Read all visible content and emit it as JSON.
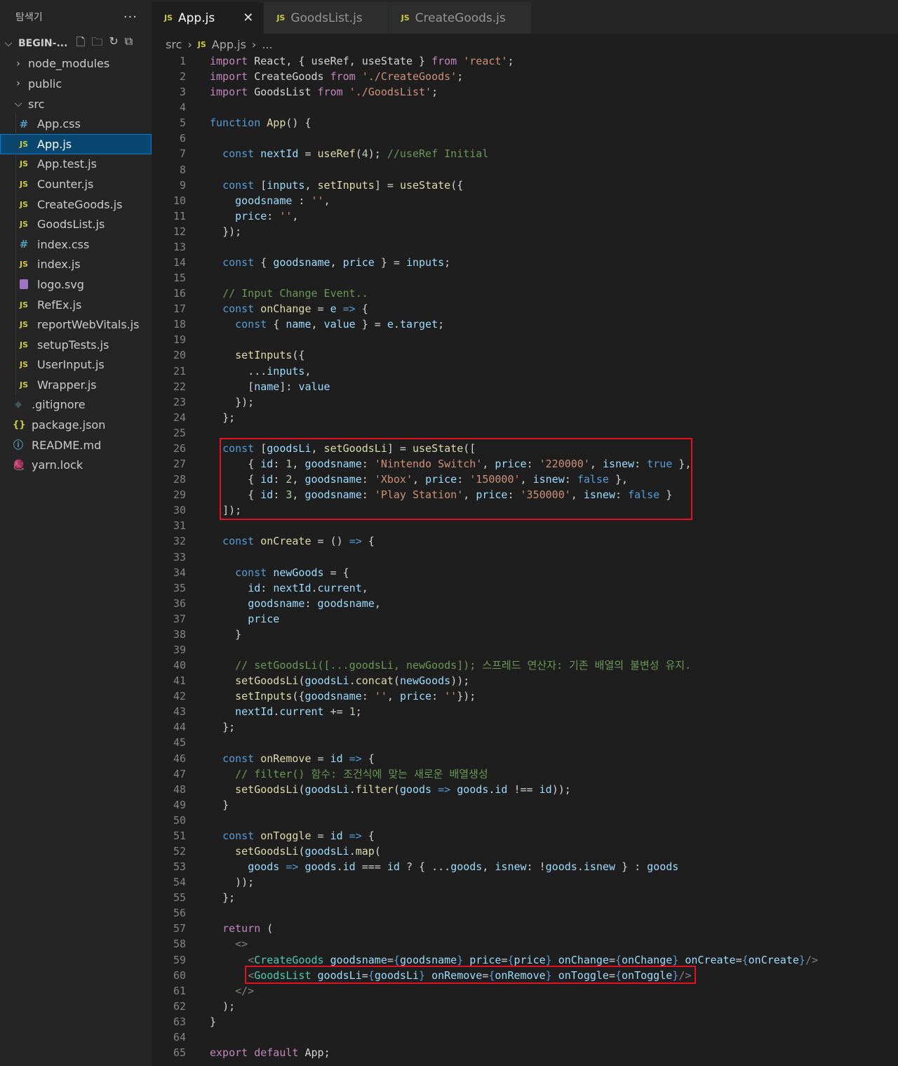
{
  "sidebar": {
    "title": "탐색기",
    "more": "···",
    "project": "BEGIN-...",
    "items": [
      {
        "label": "node_modules",
        "kind": "folder",
        "icon": "chevron-right-icon",
        "depth": 0
      },
      {
        "label": "public",
        "kind": "folder",
        "icon": "chevron-right-icon",
        "depth": 0
      },
      {
        "label": "src",
        "kind": "folder-open",
        "icon": "chevron-down-icon",
        "depth": 0
      },
      {
        "label": "App.css",
        "kind": "css",
        "icon": "hash-icon",
        "depth": 1
      },
      {
        "label": "App.js",
        "kind": "js",
        "icon": "js-icon",
        "depth": 1,
        "selected": true
      },
      {
        "label": "App.test.js",
        "kind": "js",
        "icon": "js-icon",
        "depth": 1
      },
      {
        "label": "Counter.js",
        "kind": "js",
        "icon": "js-icon",
        "depth": 1
      },
      {
        "label": "CreateGoods.js",
        "kind": "js",
        "icon": "js-icon",
        "depth": 1
      },
      {
        "label": "GoodsList.js",
        "kind": "js",
        "icon": "js-icon",
        "depth": 1
      },
      {
        "label": "index.css",
        "kind": "css",
        "icon": "hash-icon",
        "depth": 1
      },
      {
        "label": "index.js",
        "kind": "js",
        "icon": "js-icon",
        "depth": 1
      },
      {
        "label": "logo.svg",
        "kind": "svg",
        "icon": "svg-file-icon",
        "depth": 1
      },
      {
        "label": "RefEx.js",
        "kind": "js",
        "icon": "js-icon",
        "depth": 1
      },
      {
        "label": "reportWebVitals.js",
        "kind": "js",
        "icon": "js-icon",
        "depth": 1
      },
      {
        "label": "setupTests.js",
        "kind": "js",
        "icon": "js-icon",
        "depth": 1
      },
      {
        "label": "UserInput.js",
        "kind": "js",
        "icon": "js-icon",
        "depth": 1
      },
      {
        "label": "Wrapper.js",
        "kind": "js",
        "icon": "js-icon",
        "depth": 1
      },
      {
        "label": ".gitignore",
        "kind": "git",
        "icon": "git-icon",
        "depth": 0
      },
      {
        "label": "package.json",
        "kind": "json",
        "icon": "braces-icon",
        "depth": 0
      },
      {
        "label": "README.md",
        "kind": "info",
        "icon": "info-icon",
        "depth": 0
      },
      {
        "label": "yarn.lock",
        "kind": "yarn",
        "icon": "yarn-icon",
        "depth": 0
      }
    ]
  },
  "tabs": [
    {
      "label": "App.js",
      "active": true,
      "close": "✕"
    },
    {
      "label": "GoodsList.js",
      "active": false
    },
    {
      "label": "CreateGoods.js",
      "active": false
    }
  ],
  "breadcrumb": {
    "folder": "src",
    "file": "App.js",
    "more": "..."
  },
  "js_badge": "JS",
  "colors": {
    "keyword": "#569cd6",
    "control": "#c586c0",
    "string": "#ce9178",
    "variable": "#9cdcfe",
    "function": "#dcdcaa",
    "comment": "#6a9955",
    "number": "#b5cea8",
    "tag": "#4ec9b0",
    "text": "#d4d4d4",
    "highlight_box": "#e81123"
  },
  "code_lines": [
    [
      [
        "import ",
        "c"
      ],
      [
        "React",
        ""
      ],
      [
        ", { ",
        ""
      ],
      [
        "useRef",
        ""
      ],
      [
        ", ",
        ""
      ],
      [
        "useState",
        ""
      ],
      [
        " } ",
        ""
      ],
      [
        "from ",
        "c"
      ],
      [
        "'react'",
        "s"
      ],
      [
        ";",
        ""
      ]
    ],
    [
      [
        "import ",
        "c"
      ],
      [
        "CreateGoods ",
        ""
      ],
      [
        "from ",
        "c"
      ],
      [
        "'./CreateGoods'",
        "s"
      ],
      [
        ";",
        ""
      ]
    ],
    [
      [
        "import ",
        "c"
      ],
      [
        "GoodsList ",
        ""
      ],
      [
        "from ",
        "c"
      ],
      [
        "'./GoodsList'",
        "s"
      ],
      [
        ";",
        ""
      ]
    ],
    [],
    [
      [
        "function ",
        "k"
      ],
      [
        "App",
        "f"
      ],
      [
        "() {",
        ""
      ]
    ],
    [],
    [
      [
        "  "
      ],
      [
        "const ",
        "k"
      ],
      [
        "nextId",
        "v"
      ],
      [
        " = ",
        ""
      ],
      [
        "useRef",
        "f"
      ],
      [
        "(",
        ""
      ],
      [
        "4",
        "n"
      ],
      [
        "); ",
        ""
      ],
      [
        "//useRef Initial",
        "m"
      ]
    ],
    [],
    [
      [
        "  "
      ],
      [
        "const ",
        "k"
      ],
      [
        "[",
        ""
      ],
      [
        "inputs",
        "v"
      ],
      [
        ", ",
        ""
      ],
      [
        "setInputs",
        "f"
      ],
      [
        "] = ",
        ""
      ],
      [
        "useState",
        "f"
      ],
      [
        "({",
        ""
      ]
    ],
    [
      [
        "    "
      ],
      [
        "goodsname",
        "v"
      ],
      [
        " : ",
        ""
      ],
      [
        "''",
        "s"
      ],
      [
        ",",
        ""
      ]
    ],
    [
      [
        "    "
      ],
      [
        "price",
        "v"
      ],
      [
        ": ",
        ""
      ],
      [
        "''",
        "s"
      ],
      [
        ",",
        ""
      ]
    ],
    [
      [
        "  "
      ],
      [
        "});",
        ""
      ]
    ],
    [],
    [
      [
        "  "
      ],
      [
        "const ",
        "k"
      ],
      [
        "{ ",
        ""
      ],
      [
        "goodsname",
        "v"
      ],
      [
        ", ",
        ""
      ],
      [
        "price",
        "v"
      ],
      [
        " } = ",
        ""
      ],
      [
        "inputs",
        "v"
      ],
      [
        ";",
        ""
      ]
    ],
    [],
    [
      [
        "  "
      ],
      [
        "// Input Change Event..",
        "m"
      ]
    ],
    [
      [
        "  "
      ],
      [
        "const ",
        "k"
      ],
      [
        "onChange",
        "f"
      ],
      [
        " = ",
        ""
      ],
      [
        "e",
        "v"
      ],
      [
        " => ",
        "k"
      ],
      [
        "{",
        ""
      ]
    ],
    [
      [
        "    "
      ],
      [
        "const ",
        "k"
      ],
      [
        "{ ",
        ""
      ],
      [
        "name",
        "v"
      ],
      [
        ", ",
        ""
      ],
      [
        "value",
        "v"
      ],
      [
        " } = ",
        ""
      ],
      [
        "e",
        "v"
      ],
      [
        ".",
        ""
      ],
      [
        "target",
        "v"
      ],
      [
        ";",
        ""
      ]
    ],
    [],
    [
      [
        "    "
      ],
      [
        "setInputs",
        "f"
      ],
      [
        "({",
        ""
      ]
    ],
    [
      [
        "      "
      ],
      [
        "...",
        ""
      ],
      [
        "inputs",
        "v"
      ],
      [
        ",",
        ""
      ]
    ],
    [
      [
        "      "
      ],
      [
        "[",
        ""
      ],
      [
        "name",
        "v"
      ],
      [
        "]: ",
        ""
      ],
      [
        "value",
        "v"
      ]
    ],
    [
      [
        "    "
      ],
      [
        "});",
        ""
      ]
    ],
    [
      [
        "  "
      ],
      [
        "};",
        ""
      ]
    ],
    [],
    [
      [
        "  "
      ],
      [
        "const ",
        "k"
      ],
      [
        "[",
        ""
      ],
      [
        "goodsLi",
        "v"
      ],
      [
        ", ",
        ""
      ],
      [
        "setGoodsLi",
        "f"
      ],
      [
        "] = ",
        ""
      ],
      [
        "useState",
        "f"
      ],
      [
        "([",
        ""
      ]
    ],
    [
      [
        "      "
      ],
      [
        "{ ",
        ""
      ],
      [
        "id",
        "v"
      ],
      [
        ": ",
        ""
      ],
      [
        "1",
        "n"
      ],
      [
        ", ",
        ""
      ],
      [
        "goodsname",
        "v"
      ],
      [
        ": ",
        ""
      ],
      [
        "'Nintendo Switch'",
        "s"
      ],
      [
        ", ",
        ""
      ],
      [
        "price",
        "v"
      ],
      [
        ": ",
        ""
      ],
      [
        "'220000'",
        "s"
      ],
      [
        ", ",
        ""
      ],
      [
        "isnew",
        "v"
      ],
      [
        ": ",
        ""
      ],
      [
        "true",
        "k"
      ],
      [
        " },",
        ""
      ]
    ],
    [
      [
        "      "
      ],
      [
        "{ ",
        ""
      ],
      [
        "id",
        "v"
      ],
      [
        ": ",
        ""
      ],
      [
        "2",
        "n"
      ],
      [
        ", ",
        ""
      ],
      [
        "goodsname",
        "v"
      ],
      [
        ": ",
        ""
      ],
      [
        "'Xbox'",
        "s"
      ],
      [
        ", ",
        ""
      ],
      [
        "price",
        "v"
      ],
      [
        ": ",
        ""
      ],
      [
        "'150000'",
        "s"
      ],
      [
        ", ",
        ""
      ],
      [
        "isnew",
        "v"
      ],
      [
        ": ",
        ""
      ],
      [
        "false",
        "k"
      ],
      [
        " },",
        ""
      ]
    ],
    [
      [
        "      "
      ],
      [
        "{ ",
        ""
      ],
      [
        "id",
        "v"
      ],
      [
        ": ",
        ""
      ],
      [
        "3",
        "n"
      ],
      [
        ", ",
        ""
      ],
      [
        "goodsname",
        "v"
      ],
      [
        ": ",
        ""
      ],
      [
        "'Play Station'",
        "s"
      ],
      [
        ", ",
        ""
      ],
      [
        "price",
        "v"
      ],
      [
        ": ",
        ""
      ],
      [
        "'350000'",
        "s"
      ],
      [
        ", ",
        ""
      ],
      [
        "isnew",
        "v"
      ],
      [
        ": ",
        ""
      ],
      [
        "false",
        "k"
      ],
      [
        " }",
        ""
      ]
    ],
    [
      [
        "  "
      ],
      [
        "]);",
        ""
      ]
    ],
    [],
    [
      [
        "  "
      ],
      [
        "const ",
        "k"
      ],
      [
        "onCreate",
        "f"
      ],
      [
        " = () ",
        ""
      ],
      [
        "=> ",
        "k"
      ],
      [
        "{",
        ""
      ]
    ],
    [],
    [
      [
        "    "
      ],
      [
        "const ",
        "k"
      ],
      [
        "newGoods",
        "v"
      ],
      [
        " = {",
        ""
      ]
    ],
    [
      [
        "      "
      ],
      [
        "id",
        "v"
      ],
      [
        ": ",
        ""
      ],
      [
        "nextId",
        "v"
      ],
      [
        ".",
        ""
      ],
      [
        "current",
        "v"
      ],
      [
        ",",
        ""
      ]
    ],
    [
      [
        "      "
      ],
      [
        "goodsname",
        "v"
      ],
      [
        ": ",
        ""
      ],
      [
        "goodsname",
        "v"
      ],
      [
        ",",
        ""
      ]
    ],
    [
      [
        "      "
      ],
      [
        "price",
        "v"
      ]
    ],
    [
      [
        "    "
      ],
      [
        "}",
        ""
      ]
    ],
    [],
    [
      [
        "    "
      ],
      [
        "// setGoodsLi([...goodsLi, newGoods]); 스프레드 연산자: 기존 배열의 불변성 유지.",
        "m"
      ]
    ],
    [
      [
        "    "
      ],
      [
        "setGoodsLi",
        "f"
      ],
      [
        "(",
        ""
      ],
      [
        "goodsLi",
        "v"
      ],
      [
        ".",
        ""
      ],
      [
        "concat",
        "f"
      ],
      [
        "(",
        ""
      ],
      [
        "newGoods",
        "v"
      ],
      [
        "));",
        ""
      ]
    ],
    [
      [
        "    "
      ],
      [
        "setInputs",
        "f"
      ],
      [
        "({",
        ""
      ],
      [
        "goodsname",
        "v"
      ],
      [
        ": ",
        ""
      ],
      [
        "''",
        "s"
      ],
      [
        ", ",
        ""
      ],
      [
        "price",
        "v"
      ],
      [
        ": ",
        ""
      ],
      [
        "''",
        "s"
      ],
      [
        "});",
        ""
      ]
    ],
    [
      [
        "    "
      ],
      [
        "nextId",
        "v"
      ],
      [
        ".",
        ""
      ],
      [
        "current",
        "v"
      ],
      [
        " += ",
        ""
      ],
      [
        "1",
        "n"
      ],
      [
        ";",
        ""
      ]
    ],
    [
      [
        "  "
      ],
      [
        "};",
        ""
      ]
    ],
    [],
    [
      [
        "  "
      ],
      [
        "const ",
        "k"
      ],
      [
        "onRemove",
        "f"
      ],
      [
        " = ",
        ""
      ],
      [
        "id",
        "v"
      ],
      [
        " => ",
        "k"
      ],
      [
        "{",
        ""
      ]
    ],
    [
      [
        "    "
      ],
      [
        "// filter() 함수: 조건식에 맞는 새로운 배열생성",
        "m"
      ]
    ],
    [
      [
        "    "
      ],
      [
        "setGoodsLi",
        "f"
      ],
      [
        "(",
        ""
      ],
      [
        "goodsLi",
        "v"
      ],
      [
        ".",
        ""
      ],
      [
        "filter",
        "f"
      ],
      [
        "(",
        ""
      ],
      [
        "goods",
        "v"
      ],
      [
        " => ",
        "k"
      ],
      [
        "goods",
        "v"
      ],
      [
        ".",
        ""
      ],
      [
        "id",
        "v"
      ],
      [
        " !== ",
        ""
      ],
      [
        "id",
        "v"
      ],
      [
        "));",
        ""
      ]
    ],
    [
      [
        "  "
      ],
      [
        "}",
        ""
      ]
    ],
    [],
    [
      [
        "  "
      ],
      [
        "const ",
        "k"
      ],
      [
        "onToggle",
        "f"
      ],
      [
        " = ",
        ""
      ],
      [
        "id",
        "v"
      ],
      [
        " => ",
        "k"
      ],
      [
        "{",
        ""
      ]
    ],
    [
      [
        "    "
      ],
      [
        "setGoodsLi",
        "f"
      ],
      [
        "(",
        ""
      ],
      [
        "goodsLi",
        "v"
      ],
      [
        ".",
        ""
      ],
      [
        "map",
        "f"
      ],
      [
        "(",
        ""
      ]
    ],
    [
      [
        "      "
      ],
      [
        "goods",
        "v"
      ],
      [
        " => ",
        "k"
      ],
      [
        "goods",
        "v"
      ],
      [
        ".",
        ""
      ],
      [
        "id",
        "v"
      ],
      [
        " === ",
        ""
      ],
      [
        "id",
        "v"
      ],
      [
        " ? { ...",
        ""
      ],
      [
        "goods",
        "v"
      ],
      [
        ", ",
        ""
      ],
      [
        "isnew",
        "v"
      ],
      [
        ": !",
        ""
      ],
      [
        "goods",
        "v"
      ],
      [
        ".",
        ""
      ],
      [
        "isnew",
        "v"
      ],
      [
        " } : ",
        ""
      ],
      [
        "goods",
        "v"
      ]
    ],
    [
      [
        "    "
      ],
      [
        "));",
        ""
      ]
    ],
    [
      [
        "  "
      ],
      [
        "};",
        ""
      ]
    ],
    [],
    [
      [
        "  "
      ],
      [
        "return ",
        "c"
      ],
      [
        "(",
        ""
      ]
    ],
    [
      [
        "    "
      ],
      [
        "<>",
        "g"
      ]
    ],
    [
      [
        "      "
      ],
      [
        "<",
        "g"
      ],
      [
        "CreateGoods ",
        "t"
      ],
      [
        "goodsname",
        "v"
      ],
      [
        "=",
        ""
      ],
      [
        "{",
        "k"
      ],
      [
        "goodsname",
        "v"
      ],
      [
        "} ",
        "k"
      ],
      [
        "price",
        "v"
      ],
      [
        "=",
        ""
      ],
      [
        "{",
        "k"
      ],
      [
        "price",
        "v"
      ],
      [
        "} ",
        "k"
      ],
      [
        "onChange",
        "v"
      ],
      [
        "=",
        ""
      ],
      [
        "{",
        "k"
      ],
      [
        "onChange",
        "v"
      ],
      [
        "} ",
        "k"
      ],
      [
        "onCreate",
        "v"
      ],
      [
        "=",
        ""
      ],
      [
        "{",
        "k"
      ],
      [
        "onCreate",
        "v"
      ],
      [
        "}",
        "k"
      ],
      [
        "/>",
        "g"
      ]
    ],
    [
      [
        "      "
      ],
      [
        "<",
        "g"
      ],
      [
        "GoodsList ",
        "t"
      ],
      [
        "goodsLi",
        "v"
      ],
      [
        "=",
        ""
      ],
      [
        "{",
        "k"
      ],
      [
        "goodsLi",
        "v"
      ],
      [
        "} ",
        "k"
      ],
      [
        "onRemove",
        "v"
      ],
      [
        "=",
        ""
      ],
      [
        "{",
        "k"
      ],
      [
        "onRemove",
        "v"
      ],
      [
        "} ",
        "k"
      ],
      [
        "onToggle",
        "v"
      ],
      [
        "=",
        ""
      ],
      [
        "{",
        "k"
      ],
      [
        "onToggle",
        "v"
      ],
      [
        "}",
        "k"
      ],
      [
        "/>",
        "g"
      ]
    ],
    [
      [
        "    "
      ],
      [
        "</>",
        "g"
      ]
    ],
    [
      [
        "  "
      ],
      [
        ");",
        ""
      ]
    ],
    [
      [
        "}",
        ""
      ]
    ],
    [],
    [
      [
        "export ",
        "c"
      ],
      [
        "default ",
        "c"
      ],
      [
        "App",
        ""
      ],
      [
        ";",
        ""
      ]
    ]
  ]
}
